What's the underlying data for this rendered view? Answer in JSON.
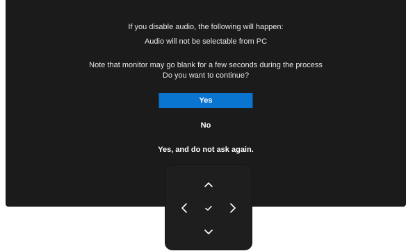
{
  "dialog": {
    "line1": "If you disable audio, the following will happen:",
    "line2": "Audio will not be selectable from PC",
    "line3": "Note that monitor may go blank for a few seconds during the process",
    "line4": "Do you want to continue?"
  },
  "options": {
    "yes": "Yes",
    "no": "No",
    "yes_dont_ask": "Yes, and do not ask again.",
    "selected": "Yes"
  },
  "colors": {
    "dialog_bg": "#1b1b1b",
    "selected_bg": "#0a74d1",
    "text": "#ffffff"
  },
  "joystick": {
    "icons": [
      "chevron-up-icon",
      "chevron-left-icon",
      "check-icon",
      "chevron-right-icon",
      "chevron-down-icon"
    ]
  }
}
